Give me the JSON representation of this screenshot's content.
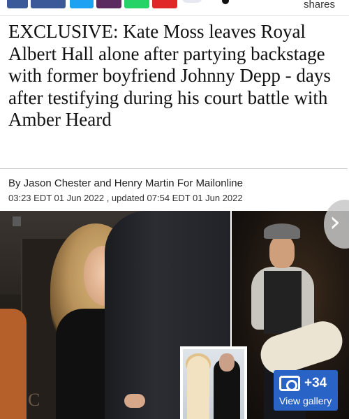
{
  "share_bar": {
    "shares_label": "shares",
    "colors": {
      "facebook": "#3b5998",
      "twitter": "#1da1f2",
      "whatsapp": "#25d366",
      "flipboard": "#e12828"
    }
  },
  "article": {
    "headline": "EXCLUSIVE: Kate Moss leaves Royal Albert Hall alone after partying backstage with former boyfriend Johnny Depp - days after testifying during his court battle with Amber Heard",
    "byline": "By Jason Chester and Henry Martin For Mailonline",
    "dateline": "03:23 EDT 01 Jun 2022 , updated 07:54 EDT 01 Jun 2022"
  },
  "hero": {
    "gallery_count": "+34",
    "gallery_label": "View gallery",
    "accent_color": "#2a63c6",
    "next_icon": "chevron-right-icon"
  }
}
